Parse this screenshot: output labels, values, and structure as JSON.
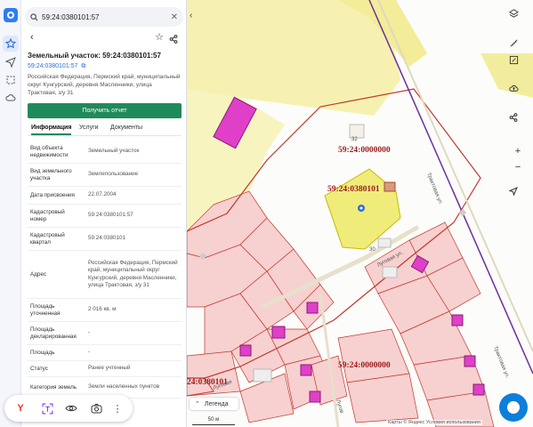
{
  "search": {
    "value": "59:24:0380101:57",
    "placeholder": ""
  },
  "header": {
    "title": "Земельный участок: 59:24:0380101:57",
    "cad_link": "59:24:0380101:57",
    "address": "Российская Федерация, Пермский край, муниципальный округ Кунгурский, деревня Масленники, улица Трактовая, з/у 31",
    "report_button": "Получить отчет"
  },
  "tabs": [
    "Информация",
    "Услуги",
    "Документы"
  ],
  "info_rows": [
    {
      "key": "Вид объекта недвижимости",
      "value": "Земельный участок"
    },
    {
      "key": "Вид земельного участка",
      "value": "Землепользование"
    },
    {
      "key": "Дата присвоения",
      "value": "22.07.2004"
    },
    {
      "key": "Кадастровый номер",
      "value": "59:24:0380101:57"
    },
    {
      "key": "Кадастровый квартал",
      "value": "59:24:0380101"
    },
    {
      "key": "Адрес",
      "value": "Российская Федерация, Пермский край, муниципальный округ Кунгурский, деревня Масленники, улица Трактовая, з/у 31"
    },
    {
      "key": "Площадь уточненная",
      "value": "2 016 кв. м"
    },
    {
      "key": "Площадь декларированная",
      "value": "-"
    },
    {
      "key": "Площадь",
      "value": "-"
    },
    {
      "key": "Статус",
      "value": "Ранее учтенный"
    },
    {
      "key": "Категория земель",
      "value": "Земли населенных пунктов"
    }
  ],
  "map": {
    "labels": {
      "top_right": "59:24:0000000",
      "quarter": "59:24:0380101",
      "bottom": "59:24:0000000",
      "bottom_left": "24:0380101",
      "road1": "Трактовая ул.",
      "road2": "Трактовая ул.",
      "street": "Луговая ул.",
      "street2": "Луговая",
      "street3": "Лугов",
      "house32": "32",
      "house30": "30"
    },
    "legend": "Легенда",
    "scale": "50 м",
    "attribution": "Карты © Яндекс  Условия использования"
  },
  "colors": {
    "accent": "#1f8a5b",
    "link": "#2e6fd8",
    "parcel_line": "#c0392b",
    "highlight": "#f0ec7a",
    "magenta": "#e040c8"
  }
}
